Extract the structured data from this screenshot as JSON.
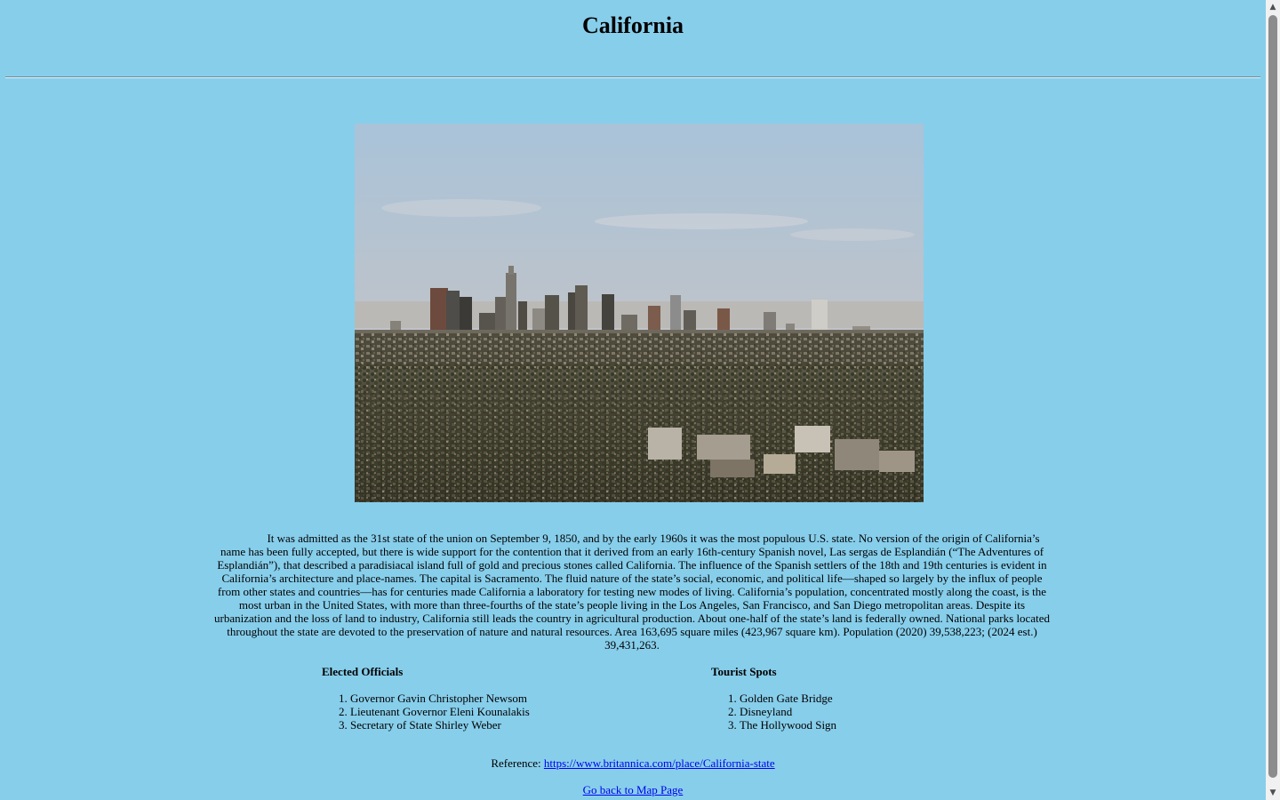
{
  "page": {
    "title": "California"
  },
  "image": {
    "alt": "Los Angeles skyline viewed from the hills"
  },
  "description": {
    "text": "It was admitted as the 31st state of the union on September 9, 1850, and by the early 1960s it was the most populous U.S. state. No version of the origin of California’s name has been fully accepted, but there is wide support for the contention that it derived from an early 16th-century Spanish novel, Las sergas de Esplandián (“The Adventures of Esplandián”), that described a paradisiacal island full of gold and precious stones called California. The influence of the Spanish settlers of the 18th and 19th centuries is evident in California’s architecture and place-names. The capital is Sacramento. The fluid nature of the state’s social, economic, and political life—shaped so largely by the influx of people from other states and countries—has for centuries made California a laboratory for testing new modes of living. California’s population, concentrated mostly along the coast, is the most urban in the United States, with more than three-fourths of the state’s people living in the Los Angeles, San Francisco, and San Diego metropolitan areas. Despite its urbanization and the loss of land to industry, California still leads the country in agricultural production. About one-half of the state’s land is federally owned. National parks located throughout the state are devoted to the preservation of nature and natural resources. Area 163,695 square miles (423,967 square km). Population (2020) 39,538,223; (2024 est.) 39,431,263."
  },
  "officials": {
    "heading": "Elected Officials",
    "items": [
      "Governor Gavin Christopher Newsom",
      "Lieutenant Governor Eleni Kounalakis",
      "Secretary of State Shirley Weber"
    ]
  },
  "tourist": {
    "heading": "Tourist Spots",
    "items": [
      "Golden Gate Bridge",
      "Disneyland",
      "The Hollywood Sign"
    ]
  },
  "reference": {
    "label": "Reference:",
    "link_text": "https://www.britannica.com/place/California-state"
  },
  "back_link": {
    "text": "Go back to Map Page"
  },
  "colors": {
    "background": "#87ceeb",
    "link": "#0000ee"
  },
  "icons": {
    "scroll_up": "triangle-up",
    "scroll_down": "triangle-down"
  }
}
